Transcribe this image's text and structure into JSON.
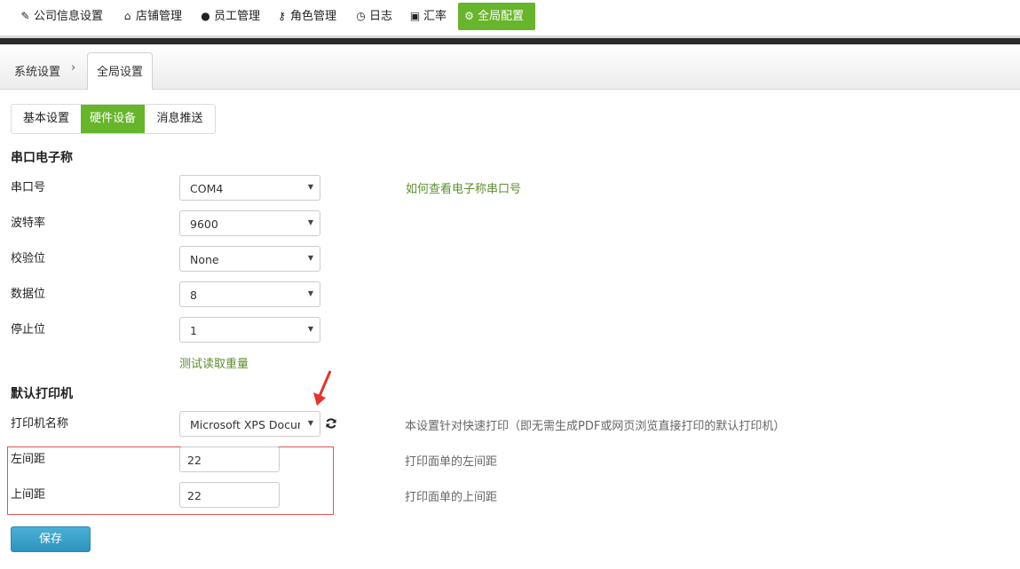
{
  "nav": {
    "items": [
      {
        "label": "公司信息设置",
        "icon": "edit-icon",
        "glyph": "✎"
      },
      {
        "label": "店铺管理",
        "icon": "home-icon",
        "glyph": "⌂"
      },
      {
        "label": "员工管理",
        "icon": "user-icon",
        "glyph": "●"
      },
      {
        "label": "角色管理",
        "icon": "key-icon",
        "glyph": "⚷"
      },
      {
        "label": "日志",
        "icon": "clock-icon",
        "glyph": "◷"
      },
      {
        "label": "汇率",
        "icon": "money-icon",
        "glyph": "▣"
      },
      {
        "label": "全局配置",
        "icon": "gear-icon",
        "glyph": "⚙"
      }
    ],
    "active_color": "#67b52a"
  },
  "breadcrumb": {
    "parent": "系统设置",
    "chevron": "›",
    "current_tab": "全局设置"
  },
  "subtabs": [
    {
      "label": "基本设置"
    },
    {
      "label": "硬件设备"
    },
    {
      "label": "消息推送"
    }
  ],
  "scale_section": {
    "title": "串口电子称",
    "fields": [
      {
        "label": "串口号",
        "value": "COM4"
      },
      {
        "label": "波特率",
        "value": "9600"
      },
      {
        "label": "校验位",
        "value": "None"
      },
      {
        "label": "数据位",
        "value": "8"
      },
      {
        "label": "停止位",
        "value": "1"
      }
    ],
    "help_link": "如何查看电子称串口号",
    "test_link": "测试读取重量"
  },
  "printer_section": {
    "title": "默认打印机",
    "printer_label": "打印机名称",
    "printer_value": "Microsoft XPS Document Writer",
    "printer_hint": "本设置针对快速打印（即无需生成PDF或网页浏览直接打印的默认打印机）",
    "left_margin_label": "左间距",
    "left_margin_value": "22",
    "left_margin_hint": "打印面单的左间距",
    "top_margin_label": "上间距",
    "top_margin_value": "22",
    "top_margin_hint": "打印面单的上间距"
  },
  "save_label": "保存",
  "colors": {
    "accent": "#67b52a",
    "link": "#5d8e2e",
    "save": "#3aa0c9",
    "highlight": "#e05555"
  }
}
